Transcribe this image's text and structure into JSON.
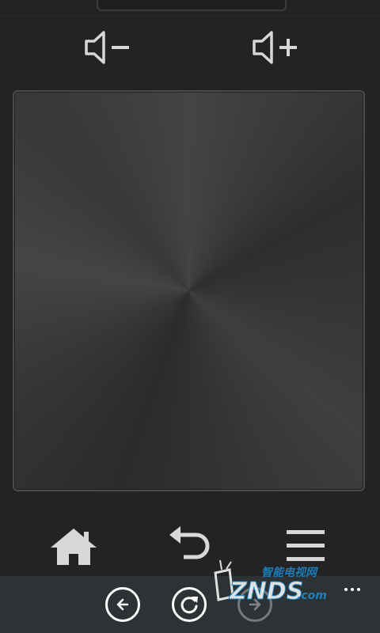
{
  "volume": {
    "down_icon": "volume-down-icon",
    "up_icon": "volume-up-icon"
  },
  "touchpad": {
    "icon": "brushed-metal-touchpad"
  },
  "nav": {
    "home_icon": "home-icon",
    "back_icon": "return-arrow-icon",
    "menu_icon": "menu-icon"
  },
  "appbar": {
    "buttons": [
      "arrow-left-icon",
      "refresh-icon",
      "arrow-right-icon"
    ],
    "more_icon": "ellipsis-icon"
  },
  "watermark": {
    "text": "ZNDS",
    "suffix": ".com",
    "cn_label": "智能电视网"
  },
  "colors": {
    "background": "#232323",
    "appbar": "#2d3234",
    "icon": "#d8d8d8",
    "watermark_blue": "#1a8fd6"
  }
}
